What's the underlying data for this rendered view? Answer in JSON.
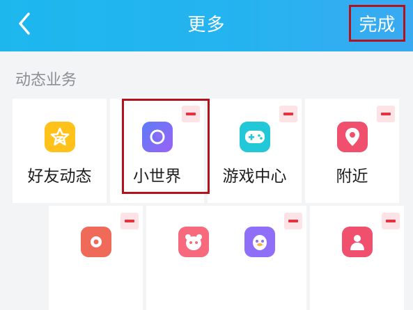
{
  "header": {
    "title": "更多",
    "done_label": "完成",
    "back_icon": "chevron-left-icon",
    "background": "#22b5ef"
  },
  "section": {
    "title": "动态业务"
  },
  "tiles": [
    {
      "label": "好友动态",
      "icon": "friend-feed-star-icon",
      "color": "#ffc21a",
      "removable": false
    },
    {
      "label": "小世界",
      "icon": "small-world-planet-icon",
      "color": "#7b6cf6",
      "removable": true
    },
    {
      "label": "游戏中心",
      "icon": "gamepad-icon",
      "color": "#22c7d8",
      "removable": true
    },
    {
      "label": "附近",
      "icon": "location-pin-icon",
      "color": "#f0506e",
      "removable": true
    },
    {
      "label": "",
      "icon": "red-app-icon",
      "color": "#f06a5a",
      "removable": true
    },
    {
      "label": "",
      "icon": "panda-face-icon",
      "color": "#f76a7e",
      "removable": true
    },
    {
      "label": "",
      "icon": "penguin-face-icon",
      "color": "#8f6ef8",
      "removable": true
    },
    {
      "label": "",
      "icon": "red-person-icon",
      "color": "#f0506e",
      "removable": true
    }
  ],
  "colors": {
    "highlight_border": "#b3121c",
    "remove_badge": "#e5323f"
  }
}
